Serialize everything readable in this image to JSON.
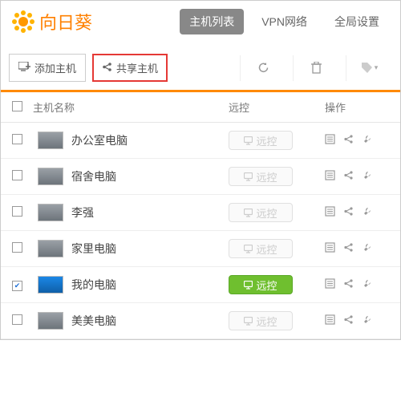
{
  "app_name": "向日葵",
  "nav": {
    "hosts": "主机列表",
    "vpn": "VPN网络",
    "settings": "全局设置"
  },
  "toolbar": {
    "add_host": "添加主机",
    "share_host": "共享主机"
  },
  "columns": {
    "name": "主机名称",
    "remote": "远控",
    "ops": "操作"
  },
  "remote_label": "远控",
  "hosts": [
    {
      "name": "办公室电脑",
      "online": false,
      "checked": false,
      "blue": false
    },
    {
      "name": "宿舍电脑",
      "online": false,
      "checked": false,
      "blue": false
    },
    {
      "name": "李强",
      "online": false,
      "checked": false,
      "blue": false
    },
    {
      "name": "家里电脑",
      "online": false,
      "checked": false,
      "blue": false
    },
    {
      "name": "我的电脑",
      "online": true,
      "checked": true,
      "blue": true
    },
    {
      "name": "美美电脑",
      "online": false,
      "checked": false,
      "blue": false
    }
  ]
}
